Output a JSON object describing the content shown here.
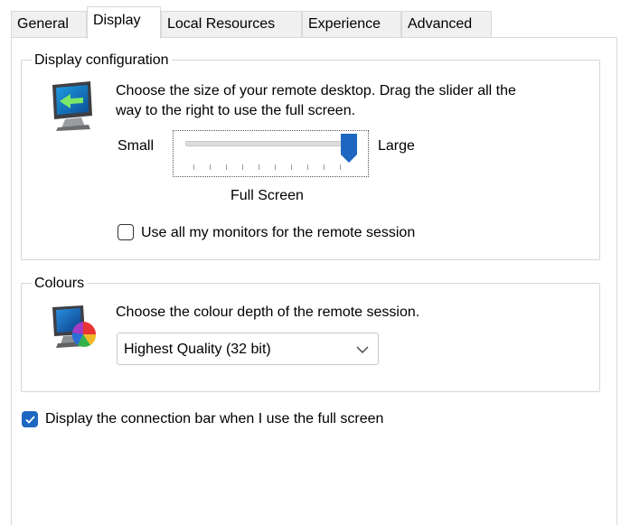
{
  "tabs": [
    {
      "label": "General"
    },
    {
      "label": "Display"
    },
    {
      "label": "Local Resources"
    },
    {
      "label": "Experience"
    },
    {
      "label": "Advanced"
    }
  ],
  "active_tab": "Display",
  "display_configuration": {
    "title": "Display configuration",
    "description_line1": "Choose the size of your remote desktop. Drag the slider all the",
    "description_line2": "way to the right to use the full screen.",
    "slider": {
      "min_label": "Small",
      "max_label": "Large",
      "value_label": "Full Screen",
      "position_fraction": 1.0,
      "tick_count": 10
    },
    "monitors_checkbox": {
      "label": "Use all my monitors for the remote session",
      "checked": false
    }
  },
  "colours": {
    "title": "Colours",
    "description": "Choose the colour depth of the remote session.",
    "depth_select": {
      "value": "Highest Quality (32 bit)"
    }
  },
  "connection_bar_checkbox": {
    "label": "Display the connection bar when I use the full screen",
    "checked": true
  },
  "accent_color": "#1e67c1"
}
